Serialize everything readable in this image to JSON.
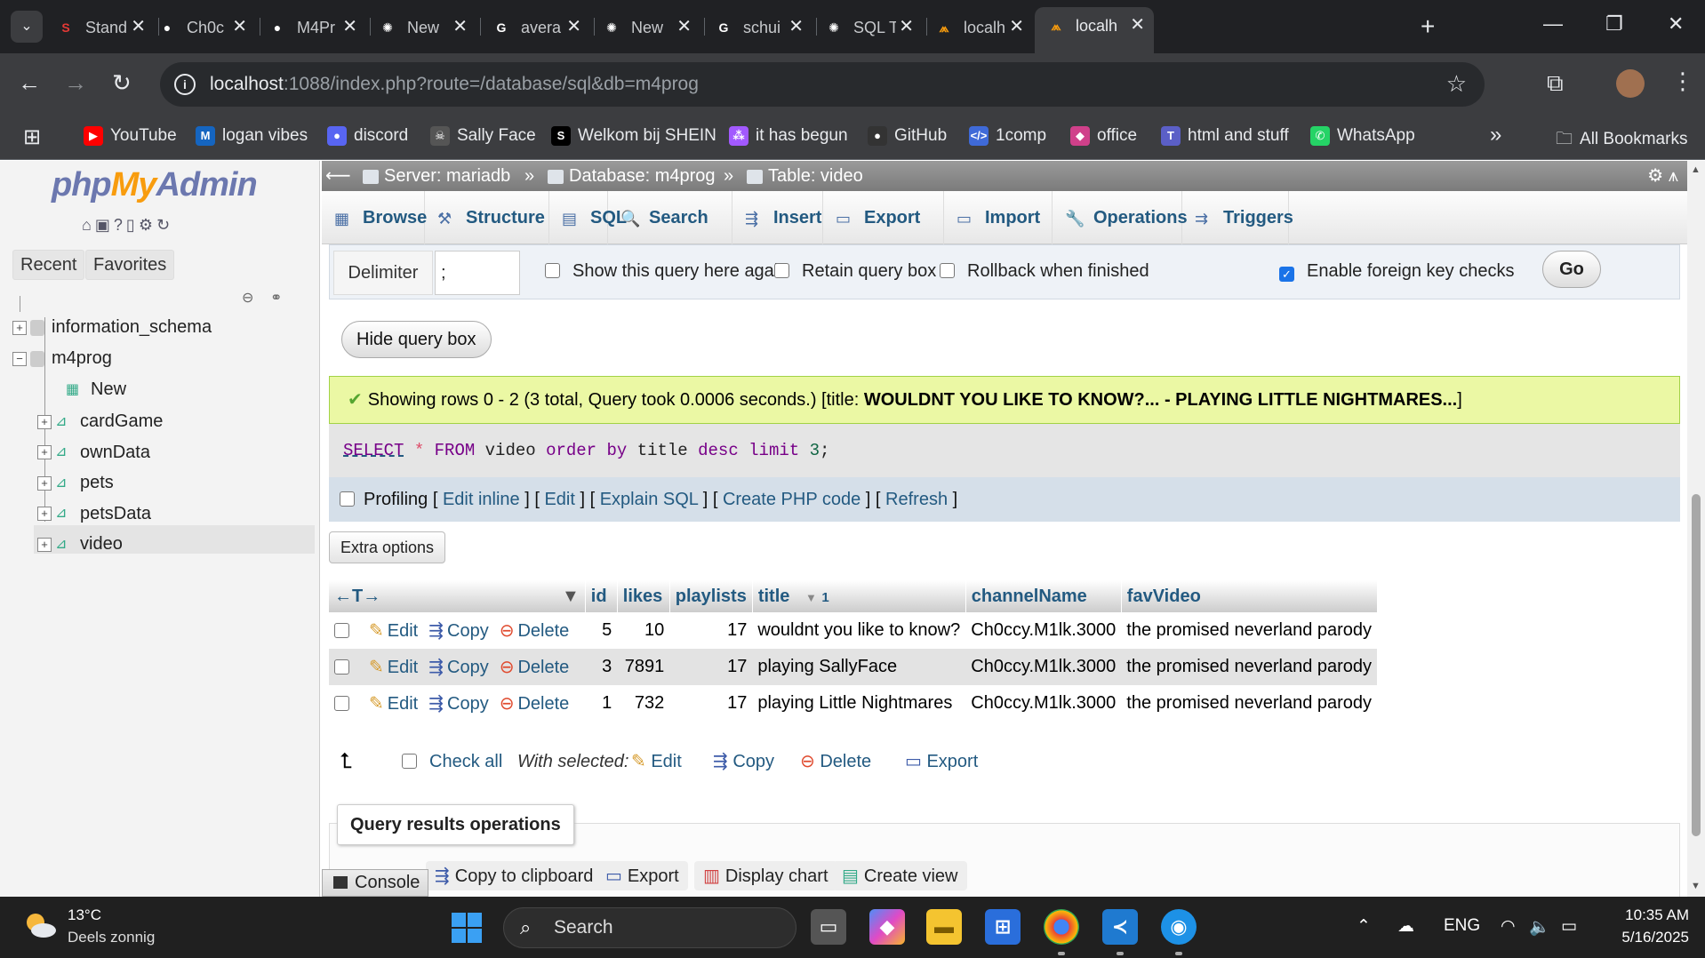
{
  "browser": {
    "tabs": [
      {
        "title": "Stand",
        "favicon": "s-icon",
        "color": "#e53935"
      },
      {
        "title": "Ch0c",
        "favicon": "github-icon",
        "color": "#ffffff"
      },
      {
        "title": "M4Pr",
        "favicon": "github-icon",
        "color": "#ffffff"
      },
      {
        "title": "New",
        "favicon": "chatgpt-icon",
        "color": "#ffffff"
      },
      {
        "title": "avera",
        "favicon": "google-icon",
        "color": "#ffffff"
      },
      {
        "title": "New",
        "favicon": "chatgpt-icon",
        "color": "#ffffff"
      },
      {
        "title": "schui",
        "favicon": "google-icon",
        "color": "#ffffff"
      },
      {
        "title": "SQL T",
        "favicon": "chatgpt-icon",
        "color": "#ffffff"
      },
      {
        "title": "localh",
        "favicon": "phpmyadmin-icon",
        "color": "#f89c0e"
      },
      {
        "title": "localh",
        "favicon": "phpmyadmin-icon",
        "color": "#f89c0e"
      }
    ],
    "url_host": "localhost",
    "url_rest": ":1088/index.php?route=/database/sql&db=m4prog",
    "bookmarks": [
      {
        "label": "YouTube",
        "icon": "youtube-icon",
        "color": "#ff0000",
        "glyph": "▶"
      },
      {
        "label": "logan vibes",
        "icon": "m-icon",
        "color": "#1565c0",
        "glyph": "M"
      },
      {
        "label": "discord",
        "icon": "discord-icon",
        "color": "#5865f2",
        "glyph": "●"
      },
      {
        "label": "Sally Face",
        "icon": "skull-icon",
        "color": "#555555",
        "glyph": "☠"
      },
      {
        "label": "Welkom bij SHEIN",
        "icon": "s-icon",
        "color": "#000000",
        "glyph": "S"
      },
      {
        "label": "it has begun",
        "icon": "figma-icon",
        "color": "#a259ff",
        "glyph": "⁂"
      },
      {
        "label": "GitHub",
        "icon": "github-icon",
        "color": "#333333",
        "glyph": "●"
      },
      {
        "label": "1comp",
        "icon": "code-icon",
        "color": "#3f6ad8",
        "glyph": "</>"
      },
      {
        "label": "office",
        "icon": "copilot-icon",
        "color": "#d0408a",
        "glyph": "◆"
      },
      {
        "label": "html and stuff",
        "icon": "teams-icon",
        "color": "#5b5fc7",
        "glyph": "T"
      },
      {
        "label": "WhatsApp",
        "icon": "whatsapp-icon",
        "color": "#25d366",
        "glyph": "✆"
      }
    ],
    "more_glyph": "»",
    "all_bookmarks": "All Bookmarks"
  },
  "nav": {
    "logo_php": "php",
    "logo_my": "My",
    "logo_admin": "Admin",
    "recent": "Recent",
    "favorites": "Favorites",
    "databases": [
      "information_schema",
      "m4prog"
    ],
    "new_label": "New",
    "tables": [
      "cardGame",
      "ownData",
      "pets",
      "petsData",
      "video"
    ]
  },
  "breadcrumb": {
    "server": "Server: mariadb",
    "database": "Database: m4prog",
    "table": "Table: video",
    "sep": "»"
  },
  "tabs": [
    {
      "label": "Browse",
      "glyph": "▦"
    },
    {
      "label": "Structure",
      "glyph": "⚒"
    },
    {
      "label": "SQL",
      "glyph": "▤"
    },
    {
      "label": "Search",
      "glyph": "🔍"
    },
    {
      "label": "Insert",
      "glyph": "⇶"
    },
    {
      "label": "Export",
      "glyph": "▭"
    },
    {
      "label": "Import",
      "glyph": "▭"
    },
    {
      "label": "Operations",
      "glyph": "🔧"
    },
    {
      "label": "Triggers",
      "glyph": "⇉"
    }
  ],
  "query_options": {
    "delimiter_label": "Delimiter",
    "delimiter_value": ";",
    "show_query_again": "Show this query here again",
    "retain_query_box": "Retain query box",
    "rollback": "Rollback when finished",
    "foreign_key": "Enable foreign key checks",
    "go": "Go"
  },
  "hide_query_box": "Hide query box",
  "message": {
    "prefix": "Showing rows 0 - 2 (3 total, Query took 0.0006 seconds.) [title: ",
    "bold": "WOULDNT YOU LIKE TO KNOW?... - PLAYING LITTLE NIGHTMARES...",
    "suffix": "]"
  },
  "sql": {
    "select": "SELECT",
    "star": "*",
    "from": "FROM",
    "table": "video",
    "order_by": "order by",
    "column": "title",
    "desc": "desc",
    "limit": "limit",
    "limit_value": "3",
    "end": ";"
  },
  "profiling": {
    "label": "Profiling",
    "edit_inline": "Edit inline",
    "edit": "Edit",
    "explain": "Explain SQL",
    "php": "Create PHP code",
    "refresh": "Refresh"
  },
  "extra_options": "Extra options",
  "table": {
    "columns": [
      "id",
      "likes",
      "playlists",
      "title",
      "channelName",
      "favVideo"
    ],
    "sort_indicator": "1",
    "actions": {
      "edit": "Edit",
      "copy": "Copy",
      "delete": "Delete"
    },
    "rows": [
      {
        "id": "5",
        "likes": "10",
        "playlists": "17",
        "title": "wouldnt you like to know?",
        "channelName": "Ch0ccy.M1lk.3000",
        "favVideo": "the promised neverland parody"
      },
      {
        "id": "3",
        "likes": "7891",
        "playlists": "17",
        "title": "playing SallyFace",
        "channelName": "Ch0ccy.M1lk.3000",
        "favVideo": "the promised neverland parody"
      },
      {
        "id": "1",
        "likes": "732",
        "playlists": "17",
        "title": "playing Little Nightmares",
        "channelName": "Ch0ccy.M1lk.3000",
        "favVideo": "the promised neverland parody"
      }
    ]
  },
  "bulk": {
    "check_all": "Check all",
    "with_selected": "With selected:",
    "edit": "Edit",
    "copy": "Copy",
    "delete": "Delete",
    "export": "Export"
  },
  "qro": {
    "legend": "Query results operations",
    "items": [
      "Copy to clipboard",
      "Export",
      "Display chart",
      "Create view"
    ]
  },
  "console": "Console",
  "taskbar": {
    "temp": "13°C",
    "weather": "Deels zonnig",
    "search": "Search",
    "lang": "ENG",
    "time": "10:35 AM",
    "date": "5/16/2025"
  }
}
